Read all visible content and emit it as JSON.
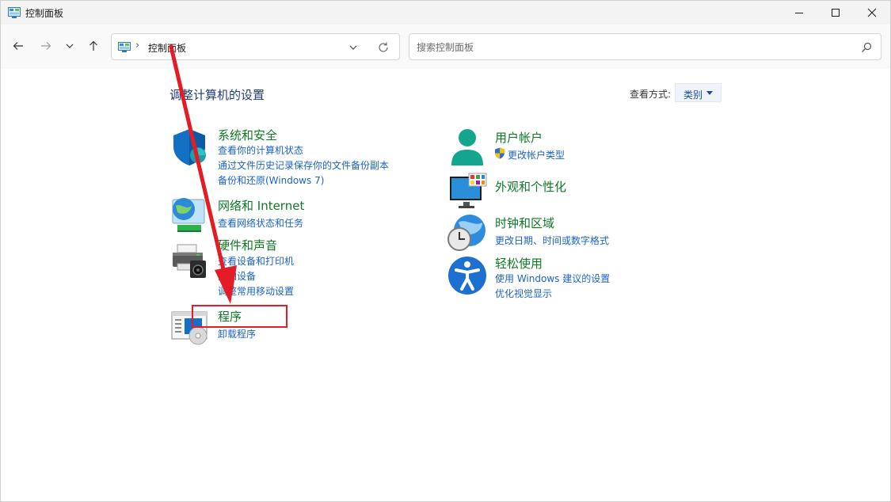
{
  "window": {
    "title": "控制面板"
  },
  "nav": {
    "address": "控制面板",
    "separator": "›",
    "search_placeholder": "搜索控制面板"
  },
  "content": {
    "heading": "调整计算机的设置",
    "view_by_label": "查看方式:",
    "view_by_value": "类别"
  },
  "categories": {
    "system": {
      "title": "系统和安全",
      "links": [
        "查看你的计算机状态",
        "通过文件历史记录保存你的文件备份副本",
        "备份和还原(Windows 7)"
      ]
    },
    "network": {
      "title": "网络和 Internet",
      "links": [
        "查看网络状态和任务"
      ]
    },
    "hardware": {
      "title": "硬件和声音",
      "links": [
        "查看设备和打印机",
        "添加设备",
        "调整常用移动设置"
      ]
    },
    "programs": {
      "title": "程序",
      "links": [
        "卸载程序"
      ]
    },
    "users": {
      "title": "用户帐户",
      "links": [
        "更改帐户类型"
      ]
    },
    "appearance": {
      "title": "外观和个性化",
      "links": []
    },
    "clock": {
      "title": "时钟和区域",
      "links": [
        "更改日期、时间或数字格式"
      ]
    },
    "ease": {
      "title": "轻松使用",
      "links": [
        "使用 Windows 建议的设置",
        "优化视觉显示"
      ]
    }
  },
  "colors": {
    "category_title": "#0b7a23",
    "link": "#1a63c5",
    "annotation": "#e31c25"
  },
  "icons": [
    "control-panel-icon",
    "minimize-icon",
    "maximize-icon",
    "close-icon",
    "back-arrow-icon",
    "forward-arrow-icon",
    "chevron-down-icon",
    "up-arrow-icon",
    "refresh-icon",
    "search-icon",
    "shield-icon",
    "network-globe-icon",
    "printer-icon",
    "programs-icon",
    "user-icon",
    "monitor-icon",
    "clock-globe-icon",
    "accessibility-icon",
    "uac-shield-icon"
  ]
}
